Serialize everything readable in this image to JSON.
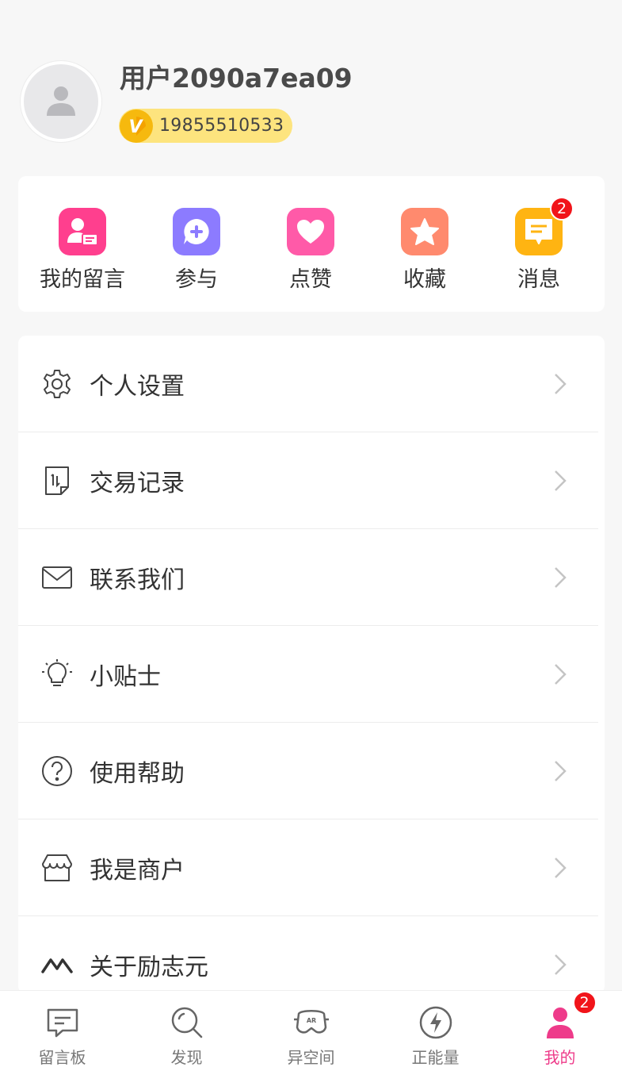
{
  "profile": {
    "username": "用户2090a7ea09",
    "phone": "19855510533",
    "vip_mark": "V"
  },
  "quick_actions": [
    {
      "label": "我的留言",
      "icon": "message-board-icon",
      "color": "#ff3f8e"
    },
    {
      "label": "参与",
      "icon": "chat-plus-icon",
      "color": "#8c7bff"
    },
    {
      "label": "点赞",
      "icon": "heart-icon",
      "color": "#ff5aa8"
    },
    {
      "label": "收藏",
      "icon": "star-icon",
      "color": "#ff8a6e"
    },
    {
      "label": "消息",
      "icon": "message-icon",
      "color": "#ffb412",
      "badge": "2"
    }
  ],
  "menu": [
    {
      "label": "个人设置",
      "icon": "gear-icon"
    },
    {
      "label": "交易记录",
      "icon": "transaction-doc-icon"
    },
    {
      "label": "联系我们",
      "icon": "envelope-icon"
    },
    {
      "label": "小贴士",
      "icon": "lightbulb-icon"
    },
    {
      "label": "使用帮助",
      "icon": "question-circle-icon"
    },
    {
      "label": "我是商户",
      "icon": "storefront-icon"
    },
    {
      "label": "关于励志元",
      "icon": "brand-wave-icon"
    }
  ],
  "tabs": [
    {
      "label": "留言板",
      "icon": "message-board-icon",
      "active": false
    },
    {
      "label": "发现",
      "icon": "search-icon",
      "active": false
    },
    {
      "label": "异空间",
      "icon": "ar-glasses-icon",
      "active": false
    },
    {
      "label": "正能量",
      "icon": "lightning-icon",
      "active": false
    },
    {
      "label": "我的",
      "icon": "user-icon",
      "active": true,
      "badge": "2"
    }
  ],
  "colors": {
    "accent": "#ee3b8a",
    "vip_pill": "#fde47e",
    "vip_badge": "#f6b90e",
    "badge": "#f1141a"
  }
}
